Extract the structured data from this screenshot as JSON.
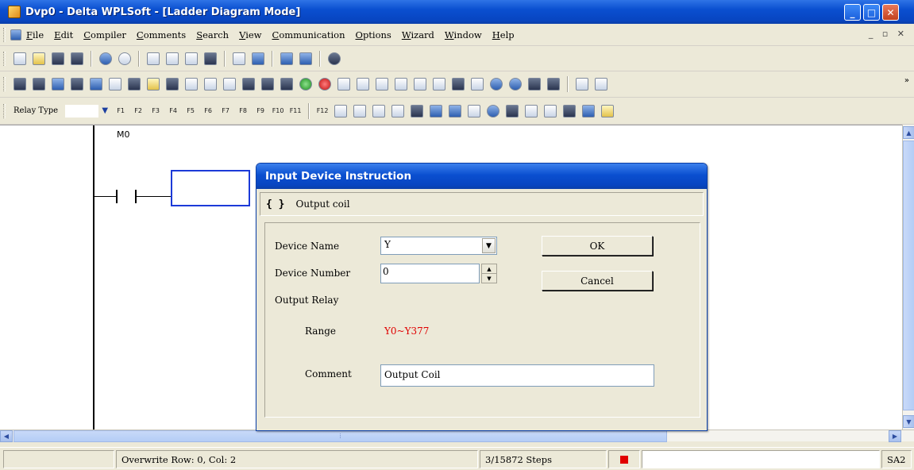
{
  "window": {
    "title": "Dvp0 - Delta WPLSoft - [Ladder Diagram Mode]",
    "caption_buttons": {
      "minimize": "_",
      "maximize": "□",
      "close": "✕"
    }
  },
  "menubar": {
    "items": [
      "File",
      "Edit",
      "Compiler",
      "Comments",
      "Search",
      "View",
      "Communication",
      "Options",
      "Wizard",
      "Window",
      "Help"
    ],
    "mdi_controls": "_ ▫ ✕"
  },
  "toolbar3": {
    "relay_type_label": "Relay Type",
    "relay_buttons": [
      "F1",
      "F2",
      "F3",
      "F4",
      "F5",
      "F6",
      "F7",
      "F8",
      "F9",
      "F10",
      "F11",
      "F12"
    ]
  },
  "ladder": {
    "contact_label": "M0"
  },
  "dialog": {
    "title": "Input Device Instruction",
    "instruction_icon": "{ }",
    "instruction_name": "Output coil",
    "device_name_label": "Device Name",
    "device_name_value": "Y",
    "device_number_label": "Device Number",
    "device_number_value": "0",
    "section_label": "Output Relay",
    "range_label": "Range",
    "range_value": "Y0~Y377",
    "comment_label": "Comment",
    "comment_value": "Output Coil",
    "ok_label": "OK",
    "cancel_label": "Cancel",
    "colors": {
      "range_value": "#e00000",
      "title_bar": "#0a4fd0"
    }
  },
  "statusbar": {
    "position": "Overwrite  Row: 0, Col: 2",
    "steps": "3/15872 Steps",
    "indicator_color": "#e10000",
    "model": "SA2"
  }
}
